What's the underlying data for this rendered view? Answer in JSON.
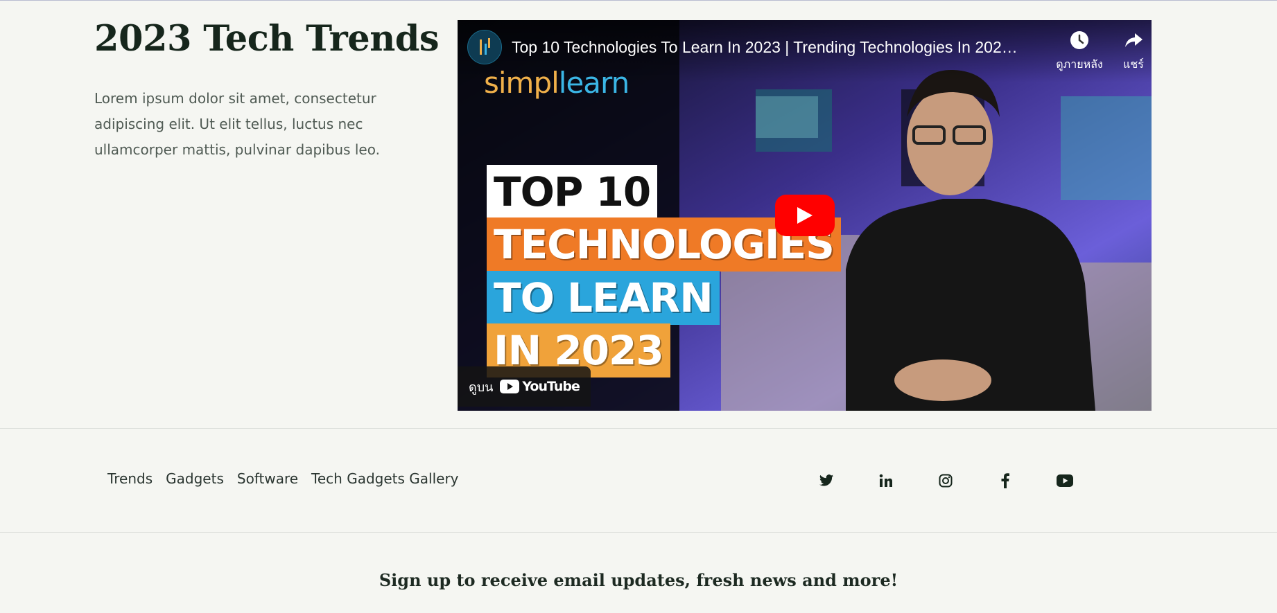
{
  "hero": {
    "title": "2023 Tech Trends",
    "text": "Lorem ipsum dolor sit amet, consectetur adipiscing elit. Ut elit tellus, luctus nec ullamcorper mattis, pulvinar dapibus leo."
  },
  "video": {
    "title": "Top 10 Technologies To Learn In 2023 | Trending Technologies In 2023 ...",
    "watch_later_label": "ดูภายหลัง",
    "share_label": "แชร์",
    "watch_on_label": "ดูบน",
    "youtube_label": "YouTube",
    "brand_logo_part1": "simpl",
    "brand_logo_part2": "learn",
    "thumb_line1": "TOP 10",
    "thumb_line2": "TECHNOLOGIES",
    "thumb_line3": "TO LEARN",
    "thumb_line4": "IN 2023"
  },
  "footer": {
    "nav": [
      "Trends",
      "Gadgets",
      "Software",
      "Tech Gadgets Gallery"
    ],
    "social_icons": [
      "twitter-icon",
      "linkedin-icon",
      "instagram-icon",
      "facebook-icon",
      "youtube-icon"
    ]
  },
  "signup": {
    "heading": "Sign up to receive email updates, fresh news and more!"
  },
  "colors": {
    "background": "#f5f6f2",
    "heading": "#16261c",
    "youtube_red": "#ff0000"
  }
}
